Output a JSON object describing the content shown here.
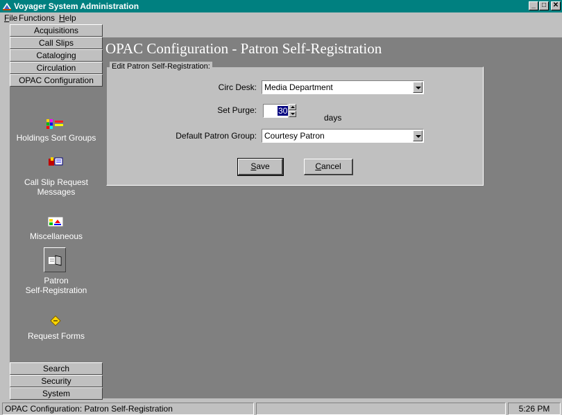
{
  "window": {
    "title": "Voyager System Administration",
    "minimize_glyph": "_",
    "maximize_glyph": "□",
    "close_glyph": "✕"
  },
  "menu": [
    {
      "label": "File",
      "mnemonic": "F",
      "rest": "ile"
    },
    {
      "label": "Functions",
      "mnemonic": "",
      "rest": "Functions"
    },
    {
      "label": "Help",
      "mnemonic": "H",
      "rest": "elp"
    }
  ],
  "sidebar": {
    "top_buttons": [
      "Acquisitions",
      "Call Slips",
      "Cataloging",
      "Circulation",
      "OPAC Configuration"
    ],
    "items": [
      {
        "label": "Holdings Sort Groups",
        "icon": "holdings-sort-icon"
      },
      {
        "label_line1": "Call Slip Request",
        "label_line2": "Messages",
        "icon": "call-slip-messages-icon"
      },
      {
        "label": "Miscellaneous",
        "icon": "miscellaneous-icon"
      },
      {
        "label_line1": "Patron",
        "label_line2": "Self-Registration",
        "icon": "patron-self-registration-icon",
        "selected": true
      },
      {
        "label": "Request Forms",
        "icon": "request-forms-icon"
      }
    ],
    "bottom_buttons": [
      "Search",
      "Security",
      "System"
    ]
  },
  "main": {
    "page_title": "OPAC Configuration - Patron Self-Registration",
    "group_legend": "Edit Patron Self-Registration:",
    "circ_desk": {
      "label": "Circ Desk:",
      "value": "Media Department"
    },
    "set_purge": {
      "label": "Set Purge:",
      "value": "30",
      "unit": "days"
    },
    "default_patron_group": {
      "label": "Default Patron Group:",
      "value": "Courtesy Patron"
    },
    "save_button": {
      "mnemonic": "S",
      "rest": "ave"
    },
    "cancel_button": {
      "mnemonic": "C",
      "rest": "ancel"
    }
  },
  "status": {
    "left": "OPAC Configuration:  Patron Self-Registration",
    "time": "5:26 PM"
  },
  "colors": {
    "title_bar": "#008080",
    "selection": "#000080",
    "panel_dark": "#808080",
    "face": "#c0c0c0"
  }
}
